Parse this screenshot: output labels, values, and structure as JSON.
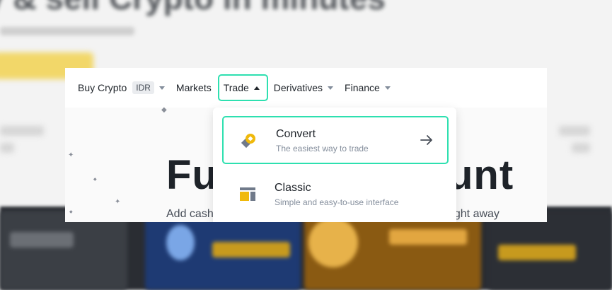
{
  "backdrop": {
    "headline": "y & sell Crypto in minutes"
  },
  "nav": {
    "buy_crypto": "Buy Crypto",
    "currency_badge": "IDR",
    "markets": "Markets",
    "trade": "Trade",
    "derivatives": "Derivatives",
    "finance": "Finance"
  },
  "hero": {
    "title": "Fu",
    "title_end": "unt",
    "subtitle_start": "Add cash",
    "subtitle_end": "right away"
  },
  "dropdown": {
    "items": [
      {
        "title": "Convert",
        "description": "The easiest way to trade",
        "icon": "convert-icon"
      },
      {
        "title": "Classic",
        "description": "Simple and easy-to-use interface",
        "icon": "classic-icon"
      }
    ]
  },
  "colors": {
    "highlight": "#2ee0b0",
    "accent": "#f0b90b",
    "text": "#1e2329",
    "muted": "#848e9c"
  }
}
